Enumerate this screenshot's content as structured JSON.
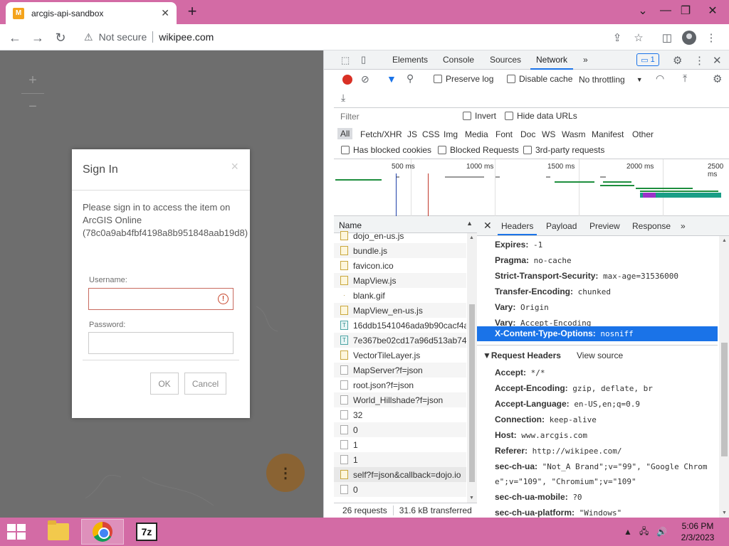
{
  "browser": {
    "tab_title": "arcgis-api-sandbox",
    "tab_favicon_letter": "M",
    "security_label": "Not secure",
    "url": "wikipee.com"
  },
  "page": {
    "zoom_in": "+",
    "zoom_out": "−",
    "fab_icon": "⋮",
    "dialog": {
      "title": "Sign In",
      "close": "×",
      "message": "Please sign in to access the item on ArcGIS Online (78c0a9ab4fbf4198a8b951848aab19d8)",
      "username_label": "Username:",
      "username_value": "",
      "password_label": "Password:",
      "password_value": "",
      "ok_label": "OK",
      "cancel_label": "Cancel"
    }
  },
  "devtools": {
    "tabs": [
      "Elements",
      "Console",
      "Sources",
      "Network"
    ],
    "active_tab": "Network",
    "more_tabs": "»",
    "issues_count": "1",
    "preserve_log": "Preserve log",
    "disable_cache": "Disable cache",
    "throttling": "No throttling",
    "filter_placeholder": "Filter",
    "invert": "Invert",
    "hide_data_urls": "Hide data URLs",
    "types": [
      "All",
      "Fetch/XHR",
      "JS",
      "CSS",
      "Img",
      "Media",
      "Font",
      "Doc",
      "WS",
      "Wasm",
      "Manifest",
      "Other"
    ],
    "has_blocked_cookies": "Has blocked cookies",
    "blocked_requests": "Blocked Requests",
    "third_party": "3rd-party requests",
    "timeline_labels": [
      "500 ms",
      "1000 ms",
      "1500 ms",
      "2000 ms",
      "2500 ms"
    ],
    "name_header": "Name",
    "requests": [
      {
        "name": "dojo_en-us.js",
        "icon": "js"
      },
      {
        "name": "bundle.js",
        "icon": "js"
      },
      {
        "name": "favicon.ico",
        "icon": "js"
      },
      {
        "name": "MapView.js",
        "icon": "js"
      },
      {
        "name": "blank.gif",
        "icon": "img"
      },
      {
        "name": "MapView_en-us.js",
        "icon": "js"
      },
      {
        "name": "16ddb1541046ada9b90cacf4a",
        "icon": "txt"
      },
      {
        "name": "7e367be02cd17a96d513ab74",
        "icon": "txt"
      },
      {
        "name": "VectorTileLayer.js",
        "icon": "js"
      },
      {
        "name": "MapServer?f=json",
        "icon": "gen"
      },
      {
        "name": "root.json?f=json",
        "icon": "gen"
      },
      {
        "name": "World_Hillshade?f=json",
        "icon": "gen"
      },
      {
        "name": "32",
        "icon": "gen"
      },
      {
        "name": "0",
        "icon": "gen"
      },
      {
        "name": "1",
        "icon": "gen"
      },
      {
        "name": "1",
        "icon": "gen"
      },
      {
        "name": "self?f=json&callback=dojo.io",
        "icon": "js"
      },
      {
        "name": "0",
        "icon": "gen"
      }
    ],
    "footer_requests": "26 requests",
    "footer_transferred": "31.6 kB transferred",
    "detail_tabs": [
      "Headers",
      "Payload",
      "Preview",
      "Response"
    ],
    "response_headers": [
      {
        "key": "Expires:",
        "value": "-1"
      },
      {
        "key": "Pragma:",
        "value": "no-cache"
      },
      {
        "key": "Strict-Transport-Security:",
        "value": "max-age=31536000"
      },
      {
        "key": "Transfer-Encoding:",
        "value": "chunked"
      },
      {
        "key": "Vary:",
        "value": "Origin"
      },
      {
        "key": "Vary:",
        "value": "Accept-Encoding"
      },
      {
        "key": "X-Content-Type-Options:",
        "value": "nosniff"
      }
    ],
    "request_headers_title": "▼Request Headers",
    "view_source": "View source",
    "request_headers": [
      {
        "key": "Accept:",
        "value": "*/*"
      },
      {
        "key": "Accept-Encoding:",
        "value": "gzip, deflate, br"
      },
      {
        "key": "Accept-Language:",
        "value": "en-US,en;q=0.9"
      },
      {
        "key": "Connection:",
        "value": "keep-alive"
      },
      {
        "key": "Host:",
        "value": "www.arcgis.com"
      },
      {
        "key": "Referer:",
        "value": "http://wikipee.com/"
      },
      {
        "key": "sec-ch-ua:",
        "value": "\"Not_A Brand\";v=\"99\", \"Google Chrom"
      },
      {
        "key": "",
        "value": "e\";v=\"109\", \"Chromium\";v=\"109\""
      },
      {
        "key": "sec-ch-ua-mobile:",
        "value": "?0"
      },
      {
        "key": "sec-ch-ua-platform:",
        "value": "\"Windows\""
      }
    ]
  },
  "taskbar": {
    "time": "5:06 PM",
    "date": "2/3/2023",
    "app_7z": "7z"
  },
  "colors": {
    "accent": "#1a73e8",
    "chrome_frame": "#d36ba5",
    "record": "#d93025"
  }
}
